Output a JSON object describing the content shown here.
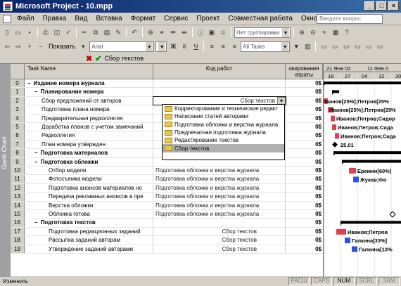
{
  "window": {
    "title": "Microsoft Project - 10.mpp"
  },
  "menu": [
    "Файл",
    "Правка",
    "Вид",
    "Вставка",
    "Формат",
    "Сервис",
    "Проект",
    "Совместная работа",
    "Окно",
    "Справка"
  ],
  "help_box": {
    "placeholder": "Введите вопрос"
  },
  "toolbar": {
    "group_combo": "Нет группировки",
    "show_label": "Показать",
    "font_combo": "Arial",
    "filter_combo": "All Tasks"
  },
  "entry_bar": {
    "value": "Сбор текстов"
  },
  "view_bar": {
    "label": "Gantt Chart"
  },
  "columns": {
    "name": "Task Name",
    "code": "Код работ",
    "cost": "окировання\nатраты"
  },
  "timescale": {
    "top": [
      "21 Янв 02",
      "11 Фев 0"
    ],
    "bottom": [
      "18",
      "27",
      "04",
      "12",
      "20"
    ]
  },
  "rows": [
    {
      "id": "0",
      "name": "Издание номера журнала",
      "indent": 0,
      "summary": true,
      "toggle": "−",
      "code": "",
      "cost": "0$"
    },
    {
      "id": "1",
      "name": "Планирование номера",
      "indent": 1,
      "summary": true,
      "toggle": "−",
      "code": "",
      "cost": "0$"
    },
    {
      "id": "2",
      "name": "Сбор предложений от авторов",
      "indent": 2,
      "summary": false,
      "toggle": "",
      "code": "Сбор текстов",
      "cost": "0$"
    },
    {
      "id": "3",
      "name": "Подготовка плана номера",
      "indent": 2,
      "summary": false,
      "toggle": "",
      "code": "",
      "cost": "0$"
    },
    {
      "id": "4",
      "name": "Предварительная редколлегия",
      "indent": 2,
      "summary": false,
      "toggle": "",
      "code": "",
      "cost": "0$"
    },
    {
      "id": "5",
      "name": "Доработка планов с учетом замечаний",
      "indent": 2,
      "summary": false,
      "toggle": "",
      "code": "",
      "cost": "0$"
    },
    {
      "id": "6",
      "name": "Редколлегия",
      "indent": 2,
      "summary": false,
      "toggle": "",
      "code": "",
      "cost": "0$"
    },
    {
      "id": "7",
      "name": "План номера утвержден",
      "indent": 2,
      "summary": false,
      "toggle": "",
      "code": "",
      "cost": "0$"
    },
    {
      "id": "8",
      "name": "Подготовка материалов",
      "indent": 1,
      "summary": true,
      "toggle": "−",
      "code": "",
      "cost": "0$"
    },
    {
      "id": "9",
      "name": "Подготовка обложки",
      "indent": 1,
      "summary": true,
      "toggle": "−",
      "code": "",
      "cost": "0$"
    },
    {
      "id": "10",
      "name": "Отбор модели",
      "indent": 3,
      "summary": false,
      "toggle": "",
      "code": "Подготовка обложки и верстка журнала",
      "cost": "0$"
    },
    {
      "id": "11",
      "name": "Фотосъемка модели",
      "indent": 3,
      "summary": false,
      "toggle": "",
      "code": "Подготовка обложки и верстка журнала",
      "cost": "0$"
    },
    {
      "id": "12",
      "name": "Подготовка анонсов материалов но",
      "indent": 3,
      "summary": false,
      "toggle": "",
      "code": "Подготовка обложки и верстка журнала",
      "cost": "0$"
    },
    {
      "id": "13",
      "name": "Передача рекламных анонсов в пре",
      "indent": 3,
      "summary": false,
      "toggle": "",
      "code": "Подготовка обложки и верстка журнала",
      "cost": "0$"
    },
    {
      "id": "14",
      "name": "Верстка обложки",
      "indent": 3,
      "summary": false,
      "toggle": "",
      "code": "Подготовка обложки и верстка журнала",
      "cost": "0$"
    },
    {
      "id": "15",
      "name": "Обложка готова",
      "indent": 3,
      "summary": false,
      "toggle": "",
      "code": "Подготовка обложки и верстка журнала",
      "cost": "0$"
    },
    {
      "id": "16",
      "name": "Подготовка текстов",
      "indent": 1,
      "summary": true,
      "toggle": "−",
      "code": "",
      "cost": "0$"
    },
    {
      "id": "17",
      "name": "Подготовка редакционных заданий",
      "indent": 3,
      "summary": false,
      "toggle": "",
      "code": "Сбор текстов",
      "cost": "0$"
    },
    {
      "id": "18",
      "name": "Рассылка заданий авторам",
      "indent": 3,
      "summary": false,
      "toggle": "",
      "code": "Сбор текстов",
      "cost": "0$"
    },
    {
      "id": "19",
      "name": "Утверждение заданий авторами",
      "indent": 3,
      "summary": false,
      "toggle": "",
      "code": "Сбор текстов",
      "cost": "0$"
    }
  ],
  "dropdown": {
    "items": [
      "Корректирование и технические редакт",
      "Написание статей авторами",
      "Подготовка обложки и верстка журнала",
      "Предпечатная подготовка журнала",
      "Редактирование текстов",
      "Сбор текстов"
    ],
    "selected_index": 5
  },
  "gantt_labels": [
    {
      "row": 2,
      "text": "Иванов[25%];Петров[25%"
    },
    {
      "row": 3,
      "text": "Иванов[25%];Петров[25%"
    },
    {
      "row": 4,
      "text": "Иванов;Петров;Сидор"
    },
    {
      "row": 5,
      "text": "Иванов;Петров;Сида"
    },
    {
      "row": 6,
      "text": "Иванов;Петров;Сида"
    },
    {
      "row": 7,
      "text": "25.01"
    },
    {
      "row": 10,
      "text": "Еремин[60%]"
    },
    {
      "row": 11,
      "text": "Жуков;Фо"
    },
    {
      "row": 17,
      "text": "Иванов;Петров"
    },
    {
      "row": 18,
      "text": "Галкина[33%]"
    },
    {
      "row": 19,
      "text": "Галкина[13%"
    }
  ],
  "status": {
    "main": "Изменить",
    "indicators": [
      "РАСШ",
      "CAPS",
      "NUM",
      "SCRL",
      "ЗАМ"
    ],
    "active": [
      "NUM"
    ]
  },
  "colors": {
    "title_start": "#0a246a",
    "title_end": "#3a6ea5",
    "task_bar": "#e04050",
    "task_bar_blue": "#3050e0",
    "summary_bar": "#000000"
  }
}
